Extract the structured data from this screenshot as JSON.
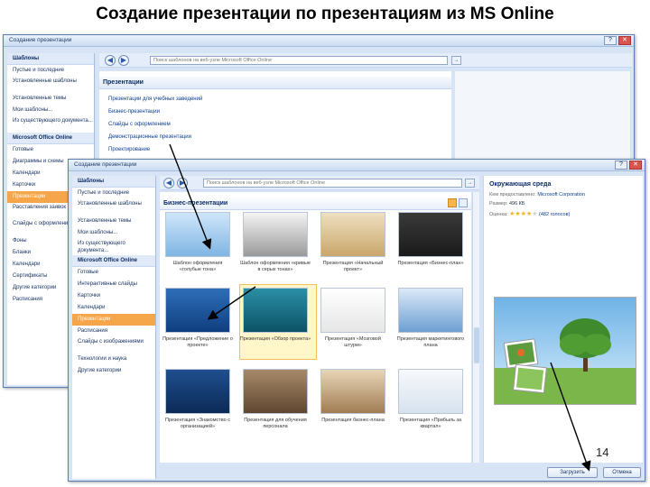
{
  "slide_title": "Создание презентации по презентациям из MS Online",
  "page_number": "14",
  "back_window": {
    "title": "Создание презентации",
    "search_placeholder": "Поиск шаблонов на веб-узле Microsoft Office Online",
    "sidebar": [
      {
        "label": "Шаблоны",
        "kind": "head"
      },
      {
        "label": "Пустые и последние",
        "kind": "item"
      },
      {
        "label": "Установленные шаблоны",
        "kind": "two"
      },
      {
        "label": "Установленные темы",
        "kind": "item"
      },
      {
        "label": "Мои шаблоны...",
        "kind": "item"
      },
      {
        "label": "Из существующего документа...",
        "kind": "two"
      },
      {
        "label": "Microsoft Office Online",
        "kind": "head"
      },
      {
        "label": "Готовые",
        "kind": "item"
      },
      {
        "label": "Диаграммы и схемы",
        "kind": "item"
      },
      {
        "label": "Календари",
        "kind": "item"
      },
      {
        "label": "Карточки",
        "kind": "item"
      },
      {
        "label": "Презентации",
        "kind": "sel"
      },
      {
        "label": "Расставления заявок",
        "kind": "two"
      },
      {
        "label": "Слайды с оформлением",
        "kind": "two"
      },
      {
        "label": "Фоны",
        "kind": "item"
      },
      {
        "label": "Бланки",
        "kind": "item"
      },
      {
        "label": "Календари",
        "kind": "item"
      },
      {
        "label": "Сертификаты",
        "kind": "item"
      },
      {
        "label": "Другие категории",
        "kind": "item"
      },
      {
        "label": "Расписания",
        "kind": "item"
      }
    ],
    "section_title": "Презентации",
    "links": [
      "Презентации для учебных заведений",
      "Бизнес-презентации",
      "Слайды с оформлением",
      "Демонстрационные презентации",
      "Проектирование"
    ]
  },
  "front_window": {
    "title": "Создание презентации",
    "search_placeholder": "Поиск шаблонов на веб-узле Microsoft Office Online",
    "sidebar": [
      {
        "label": "Шаблоны",
        "kind": "head"
      },
      {
        "label": "Пустые и последние",
        "kind": "item"
      },
      {
        "label": "Установленные шаблоны",
        "kind": "two"
      },
      {
        "label": "Установленные темы",
        "kind": "item"
      },
      {
        "label": "Мои шаблоны...",
        "kind": "item"
      },
      {
        "label": "Из существующего документа...",
        "kind": "two"
      },
      {
        "label": "Microsoft Office Online",
        "kind": "head"
      },
      {
        "label": "Готовые",
        "kind": "item"
      },
      {
        "label": "Интерактивные слайды",
        "kind": "item"
      },
      {
        "label": "Карточки",
        "kind": "item"
      },
      {
        "label": "Календари",
        "kind": "item"
      },
      {
        "label": "Презентации",
        "kind": "sel"
      },
      {
        "label": "Расписания",
        "kind": "item"
      },
      {
        "label": "Слайды с изображениями",
        "kind": "two"
      },
      {
        "label": "Технологии и наука",
        "kind": "item"
      },
      {
        "label": "Другие категории",
        "kind": "item"
      }
    ],
    "section_title": "Бизнес-презентации",
    "templates": [
      {
        "caption": "Шаблон оформления «голубые тона»",
        "style": "sky"
      },
      {
        "caption": "Шаблон оформления «кривые в серых тонах»",
        "style": "gray"
      },
      {
        "caption": "Презентация «Начальный проект»",
        "style": "parch"
      },
      {
        "caption": "Презентация «Бизнес-план»",
        "style": "dark"
      },
      {
        "caption": "Презентация «Предложение о проекте»",
        "style": "blue"
      },
      {
        "caption": "Презентация «Обзор проекта»",
        "style": "teal"
      },
      {
        "caption": "Презентация «Мозговой штурм»",
        "style": "white"
      },
      {
        "caption": "Презентация маркетингового плана",
        "style": "lblue"
      },
      {
        "caption": "Презентация «Знакомство с организацией»",
        "style": "navy"
      },
      {
        "caption": "Презентация для обучения персонала",
        "style": "people"
      },
      {
        "caption": "Презентация бизнес-плана",
        "style": "sepia"
      },
      {
        "caption": "Презентация «Прибыль за квартал»",
        "style": "pale"
      }
    ],
    "preview": {
      "title": "Окружающая среда",
      "provider_label": "Кем предоставлено:",
      "provider": "Microsoft Corporation",
      "size_label": "Размер:",
      "size": "496 КБ",
      "rating_label": "Оценка:",
      "rating": 4,
      "rating_max": 5,
      "votes": "(482 голосов)"
    },
    "buttons": {
      "download": "Загрузить",
      "cancel": "Отмена"
    }
  }
}
